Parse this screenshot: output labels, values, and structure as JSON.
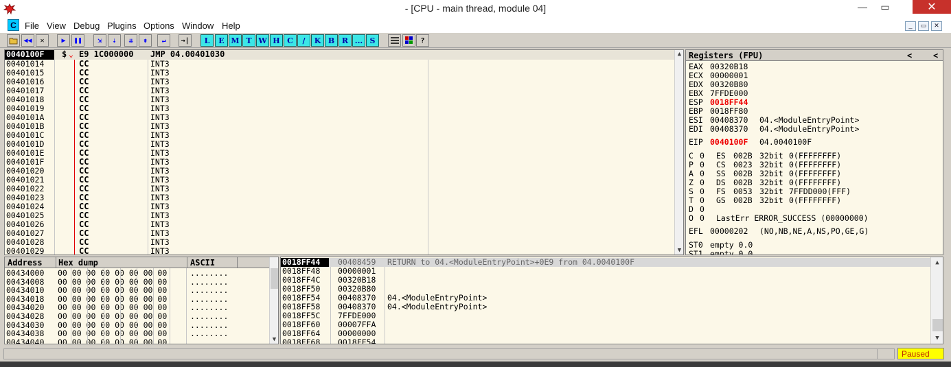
{
  "window": {
    "title": "- [CPU - main thread, module 04]"
  },
  "window_buttons": {
    "minimize": "—",
    "maximize": "▭",
    "close": "✕"
  },
  "menu": {
    "logo": "C",
    "items": [
      "File",
      "View",
      "Debug",
      "Plugins",
      "Options",
      "Window",
      "Help"
    ]
  },
  "mdi_buttons": [
    "_",
    "▭",
    "✕"
  ],
  "toolbar": {
    "letters": [
      "L",
      "E",
      "M",
      "T",
      "W",
      "H",
      "C",
      "/",
      "K",
      "B",
      "R",
      "...",
      "S"
    ]
  },
  "disasm": {
    "selected": {
      "address": "0040100F",
      "mark": "$",
      "arrow": "⌄",
      "hex": "E9 1C000000",
      "command": "JMP 04.00401030"
    },
    "rows": [
      {
        "address": "00401014",
        "hex": "CC",
        "command": "INT3"
      },
      {
        "address": "00401015",
        "hex": "CC",
        "command": "INT3"
      },
      {
        "address": "00401016",
        "hex": "CC",
        "command": "INT3"
      },
      {
        "address": "00401017",
        "hex": "CC",
        "command": "INT3"
      },
      {
        "address": "00401018",
        "hex": "CC",
        "command": "INT3"
      },
      {
        "address": "00401019",
        "hex": "CC",
        "command": "INT3"
      },
      {
        "address": "0040101A",
        "hex": "CC",
        "command": "INT3"
      },
      {
        "address": "0040101B",
        "hex": "CC",
        "command": "INT3"
      },
      {
        "address": "0040101C",
        "hex": "CC",
        "command": "INT3"
      },
      {
        "address": "0040101D",
        "hex": "CC",
        "command": "INT3"
      },
      {
        "address": "0040101E",
        "hex": "CC",
        "command": "INT3"
      },
      {
        "address": "0040101F",
        "hex": "CC",
        "command": "INT3"
      },
      {
        "address": "00401020",
        "hex": "CC",
        "command": "INT3"
      },
      {
        "address": "00401021",
        "hex": "CC",
        "command": "INT3"
      },
      {
        "address": "00401022",
        "hex": "CC",
        "command": "INT3"
      },
      {
        "address": "00401023",
        "hex": "CC",
        "command": "INT3"
      },
      {
        "address": "00401024",
        "hex": "CC",
        "command": "INT3"
      },
      {
        "address": "00401025",
        "hex": "CC",
        "command": "INT3"
      },
      {
        "address": "00401026",
        "hex": "CC",
        "command": "INT3"
      },
      {
        "address": "00401027",
        "hex": "CC",
        "command": "INT3"
      },
      {
        "address": "00401028",
        "hex": "CC",
        "command": "INT3"
      },
      {
        "address": "00401029",
        "hex": "CC",
        "command": "INT3"
      }
    ]
  },
  "registers": {
    "header": "Registers (FPU)",
    "header_arrows": [
      "<",
      "<"
    ],
    "gpr": [
      {
        "name": "EAX",
        "value": "00320B18",
        "changed": false,
        "comment": ""
      },
      {
        "name": "ECX",
        "value": "00000001",
        "changed": false,
        "comment": ""
      },
      {
        "name": "EDX",
        "value": "00320B80",
        "changed": false,
        "comment": ""
      },
      {
        "name": "EBX",
        "value": "7FFDE000",
        "changed": false,
        "comment": ""
      },
      {
        "name": "ESP",
        "value": "0018FF44",
        "changed": true,
        "comment": ""
      },
      {
        "name": "EBP",
        "value": "0018FF80",
        "changed": false,
        "comment": ""
      },
      {
        "name": "ESI",
        "value": "00408370",
        "changed": false,
        "comment": "04.<ModuleEntryPoint>"
      },
      {
        "name": "EDI",
        "value": "00408370",
        "changed": false,
        "comment": "04.<ModuleEntryPoint>"
      }
    ],
    "eip": {
      "name": "EIP",
      "value": "0040100F",
      "comment": "04.0040100F"
    },
    "flags": [
      {
        "flag": "C",
        "val": "0",
        "seg": "ES",
        "sel": "002B",
        "bits": "32bit",
        "base": "0(FFFFFFFF)"
      },
      {
        "flag": "P",
        "val": "0",
        "seg": "CS",
        "sel": "0023",
        "bits": "32bit",
        "base": "0(FFFFFFFF)"
      },
      {
        "flag": "A",
        "val": "0",
        "seg": "SS",
        "sel": "002B",
        "bits": "32bit",
        "base": "0(FFFFFFFF)"
      },
      {
        "flag": "Z",
        "val": "0",
        "seg": "DS",
        "sel": "002B",
        "bits": "32bit",
        "base": "0(FFFFFFFF)"
      },
      {
        "flag": "S",
        "val": "0",
        "seg": "FS",
        "sel": "0053",
        "bits": "32bit",
        "base": "7FFDD000(FFF)"
      },
      {
        "flag": "T",
        "val": "0",
        "seg": "GS",
        "sel": "002B",
        "bits": "32bit",
        "base": "0(FFFFFFFF)"
      },
      {
        "flag": "D",
        "val": "0",
        "seg": "",
        "sel": "",
        "bits": "",
        "base": ""
      }
    ],
    "lasterr": {
      "flag": "O",
      "val": "0",
      "text": "LastErr ERROR_SUCCESS (00000000)"
    },
    "efl": {
      "name": "EFL",
      "value": "00000202",
      "text": "(NO,NB,NE,A,NS,PO,GE,G)"
    },
    "fpu": [
      {
        "name": "ST0",
        "text": "empty 0.0"
      },
      {
        "name": "ST1",
        "text": "empty 0.0"
      }
    ]
  },
  "dump": {
    "headers": {
      "address": "Address",
      "hex": "Hex dump",
      "ascii": "ASCII"
    },
    "rows": [
      {
        "address": "00434000",
        "bytes": "00 00 00 00 00 00 00 00",
        "ascii": "........"
      },
      {
        "address": "00434008",
        "bytes": "00 00 00 00 00 00 00 00",
        "ascii": "........"
      },
      {
        "address": "00434010",
        "bytes": "00 00 00 00 00 00 00 00",
        "ascii": "........"
      },
      {
        "address": "00434018",
        "bytes": "00 00 00 00 00 00 00 00",
        "ascii": "........"
      },
      {
        "address": "00434020",
        "bytes": "00 00 00 00 00 00 00 00",
        "ascii": "........"
      },
      {
        "address": "00434028",
        "bytes": "00 00 00 00 00 00 00 00",
        "ascii": "........"
      },
      {
        "address": "00434030",
        "bytes": "00 00 00 00 00 00 00 00",
        "ascii": "........"
      },
      {
        "address": "00434038",
        "bytes": "00 00 00 00 00 00 00 00",
        "ascii": "........"
      },
      {
        "address": "00434040",
        "bytes": "00 00 00 00 00 00 00 00",
        "ascii": "........"
      }
    ]
  },
  "stack": {
    "selected": {
      "address": "0018FF44",
      "value": "00408459",
      "comment": "RETURN to 04.<ModuleEntryPoint>+0E9 from 04.0040100F"
    },
    "rows": [
      {
        "address": "0018FF48",
        "value": "00000001",
        "comment": ""
      },
      {
        "address": "0018FF4C",
        "value": "00320B18",
        "comment": ""
      },
      {
        "address": "0018FF50",
        "value": "00320B80",
        "comment": ""
      },
      {
        "address": "0018FF54",
        "value": "00408370",
        "comment": "04.<ModuleEntryPoint>"
      },
      {
        "address": "0018FF58",
        "value": "00408370",
        "comment": "04.<ModuleEntryPoint>"
      },
      {
        "address": "0018FF5C",
        "value": "7FFDE000",
        "comment": ""
      },
      {
        "address": "0018FF60",
        "value": "00007FFA",
        "comment": ""
      },
      {
        "address": "0018FF64",
        "value": "00000000",
        "comment": ""
      },
      {
        "address": "0018FF68",
        "value": "0018FF54",
        "comment": ""
      }
    ]
  },
  "status": {
    "text": "",
    "state": "Paused"
  },
  "scroll": {
    "up": "▲",
    "down": "▼"
  }
}
